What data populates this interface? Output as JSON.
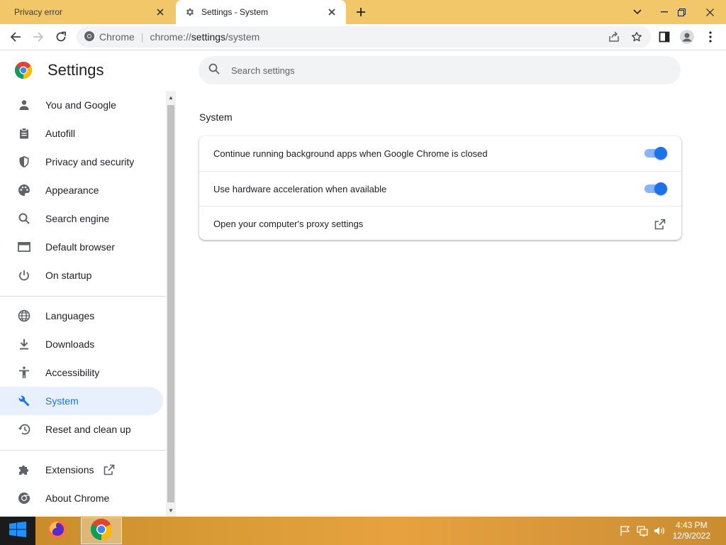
{
  "browser": {
    "tabs": [
      {
        "title": "Privacy error",
        "active": false
      },
      {
        "title": "Settings - System",
        "active": true
      }
    ],
    "omnibox": {
      "site": "Chrome",
      "url_prefix": "chrome://",
      "url_host": "settings",
      "url_path": "/system"
    }
  },
  "settings": {
    "title": "Settings",
    "search_placeholder": "Search settings",
    "nav": {
      "items": [
        {
          "label": "You and Google",
          "icon": "person-icon"
        },
        {
          "label": "Autofill",
          "icon": "clipboard-icon"
        },
        {
          "label": "Privacy and security",
          "icon": "shield-icon"
        },
        {
          "label": "Appearance",
          "icon": "palette-icon"
        },
        {
          "label": "Search engine",
          "icon": "search-icon"
        },
        {
          "label": "Default browser",
          "icon": "browser-icon"
        },
        {
          "label": "On startup",
          "icon": "power-icon"
        },
        {
          "label": "Languages",
          "icon": "globe-icon"
        },
        {
          "label": "Downloads",
          "icon": "download-icon"
        },
        {
          "label": "Accessibility",
          "icon": "accessibility-icon"
        },
        {
          "label": "System",
          "icon": "wrench-icon",
          "selected": true
        },
        {
          "label": "Reset and clean up",
          "icon": "history-icon"
        },
        {
          "label": "Extensions",
          "icon": "puzzle-icon"
        },
        {
          "label": "About Chrome",
          "icon": "chrome-icon"
        }
      ]
    },
    "system": {
      "section_title": "System",
      "rows": [
        {
          "label": "Continue running background apps when Google Chrome is closed",
          "toggle": true
        },
        {
          "label": "Use hardware acceleration when available",
          "toggle": true
        },
        {
          "label": "Open your computer's proxy settings",
          "external": true
        }
      ]
    }
  },
  "taskbar": {
    "time": "4:43 PM",
    "date": "12/9/2022"
  },
  "colors": {
    "accent": "#1a73e8",
    "tab_strip": "#f1c76a",
    "selected_nav_bg": "#e8f0fe"
  }
}
